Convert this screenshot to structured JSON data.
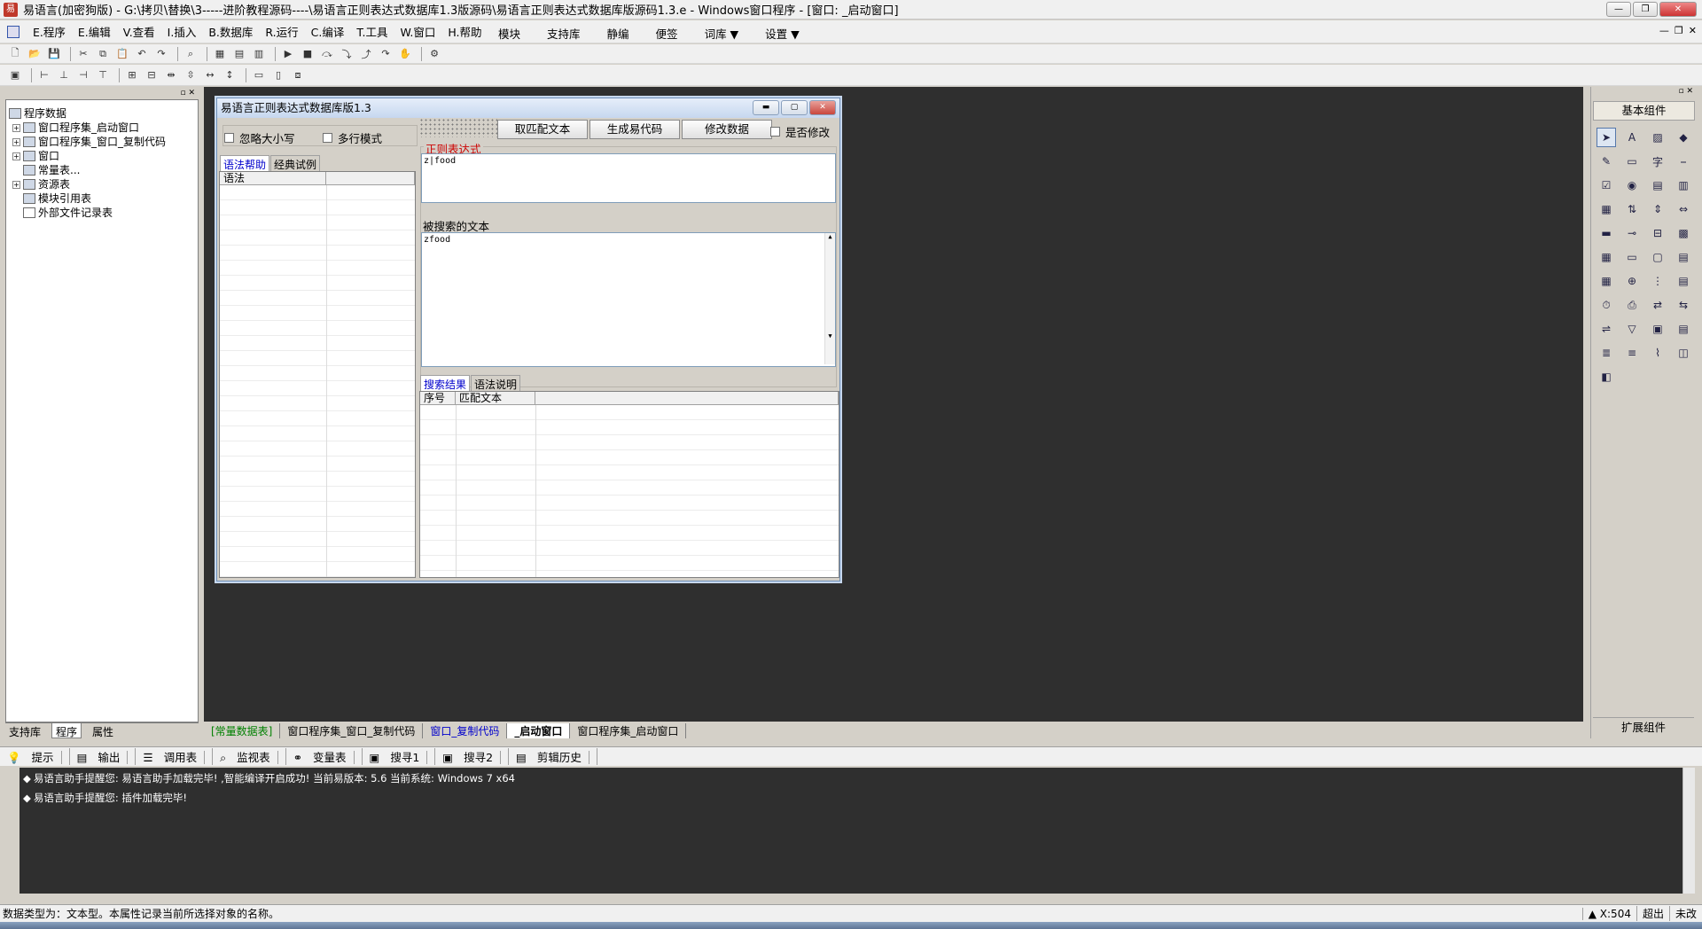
{
  "window": {
    "title": "易语言(加密狗版) - G:\\拷贝\\替换\\3-----进阶教程源码----\\易语言正则表达式数据库1.3版源码\\易语言正则表达式数据库版源码1.3.e - Windows窗口程序 - [窗口: _启动窗口]",
    "app_icon": "易"
  },
  "menu": {
    "items": [
      "E.程序",
      "E.编辑",
      "V.查看",
      "I.插入",
      "B.数据库",
      "R.运行",
      "C.编译",
      "T.工具",
      "W.窗口",
      "H.帮助"
    ],
    "right_items": [
      "模块",
      "支持库",
      "静编",
      "便签",
      "词库 ▼",
      "设置 ▼"
    ]
  },
  "left_panel": {
    "tree": [
      {
        "label": "程序数据",
        "expander": "",
        "level": 0
      },
      {
        "label": "窗口程序集_启动窗口",
        "expander": "+",
        "level": 1
      },
      {
        "label": "窗口程序集_窗口_复制代码",
        "expander": "+",
        "level": 1
      },
      {
        "label": "窗口",
        "expander": "+",
        "level": 1
      },
      {
        "label": "常量表...",
        "expander": "",
        "level": 1
      },
      {
        "label": "资源表",
        "expander": "+",
        "level": 1
      },
      {
        "label": "模块引用表",
        "expander": "",
        "level": 1
      },
      {
        "label": "外部文件记录表",
        "expander": "",
        "level": 1
      }
    ],
    "tabs": [
      "支持库",
      "程序",
      "属性"
    ],
    "active_tab": "程序"
  },
  "designer": {
    "title": "易语言正则表达式数据库版1.3",
    "checkbox_ignore_case": "忽略大小写",
    "checkbox_multiline": "多行模式",
    "btn_match": "取匹配文本",
    "btn_generate": "生成易代码",
    "btn_modify": "修改数据",
    "checkbox_modify": "是否修改",
    "left_tabs": [
      "语法帮助",
      "经典试例"
    ],
    "syntax_col": "语法",
    "regex_label": "正则表达式",
    "regex_value": "z|food",
    "search_label": "被搜索的文本",
    "search_value": "zfood",
    "result_tabs": [
      "搜索结果",
      "语法说明"
    ],
    "result_cols": [
      "序号",
      "匹配文本"
    ]
  },
  "center_tabs": [
    {
      "label": "[常量数据表]",
      "style": "cst"
    },
    {
      "label": "窗口程序集_窗口_复制代码",
      "style": ""
    },
    {
      "label": "窗口_复制代码",
      "style": "blue"
    },
    {
      "label": "_启动窗口",
      "style": "act"
    },
    {
      "label": "窗口程序集_启动窗口",
      "style": ""
    }
  ],
  "right_panel": {
    "basic_components": "基本组件",
    "extended_components": "扩展组件",
    "icon_names": [
      "pointer",
      "label",
      "picture",
      "shape",
      "edit",
      "frame",
      "text",
      "line",
      "checkbox",
      "radio",
      "listbox",
      "table",
      "grid",
      "scroll",
      "progress",
      "date",
      "timer",
      "print",
      "drive",
      "file"
    ]
  },
  "bottom": {
    "tabs": [
      "提示",
      "输出",
      "调用表",
      "监视表",
      "变量表",
      "搜寻1",
      "搜寻2",
      "剪辑历史"
    ],
    "output_lines": [
      "易语言助手提醒您: 易语言助手加载完毕! ,智能编译开启成功! 当前易版本: 5.6 当前系统: Windows 7 x64",
      "易语言助手提醒您: 插件加载完毕!"
    ]
  },
  "status": {
    "message": "数据类型为：文本型。本属性记录当前所选择对象的名称。",
    "coord": "X:504",
    "mode": "超出",
    "state": "未改"
  }
}
